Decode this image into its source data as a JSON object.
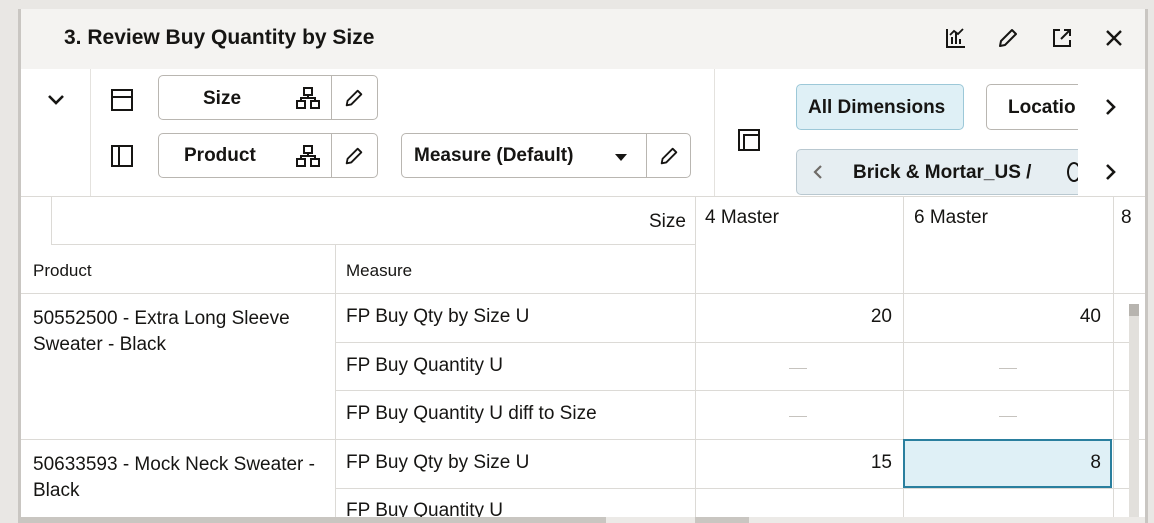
{
  "title": "3. Review Buy Quantity by Size",
  "toolbar_icons": [
    "chart-icon",
    "edit-icon",
    "expand-icon",
    "close-icon"
  ],
  "pivot": {
    "row1": {
      "tile_label": "Size"
    },
    "row2": {
      "tile_label": "Product"
    },
    "measure_select": {
      "value": "Measure (Default)"
    },
    "dims_button": "All Dimensions",
    "location_button": "Locatio",
    "location_filter": "Brick & Mortar_US /"
  },
  "grid": {
    "size_header": "Size",
    "columns": [
      "4 Master",
      "6 Master",
      "8"
    ],
    "row_headers": {
      "product": "Product",
      "measure": "Measure"
    },
    "products": [
      {
        "name": "50552500 - Extra Long Sleeve Sweater - Black",
        "rows": [
          {
            "measure": "FP Buy Qty by Size U",
            "values": [
              "20",
              "40"
            ]
          },
          {
            "measure": "FP Buy Quantity U",
            "values": [
              "—",
              "—"
            ]
          },
          {
            "measure": "FP Buy Quantity U diff to Size",
            "values": [
              "—",
              "—"
            ]
          }
        ]
      },
      {
        "name": "50633593 - Mock Neck Sweater - Black",
        "rows": [
          {
            "measure": "FP Buy Qty by Size U",
            "values": [
              "15",
              "8"
            ]
          },
          {
            "measure": "FP Buy Quantity U",
            "values": [
              "",
              ""
            ]
          }
        ]
      }
    ]
  }
}
